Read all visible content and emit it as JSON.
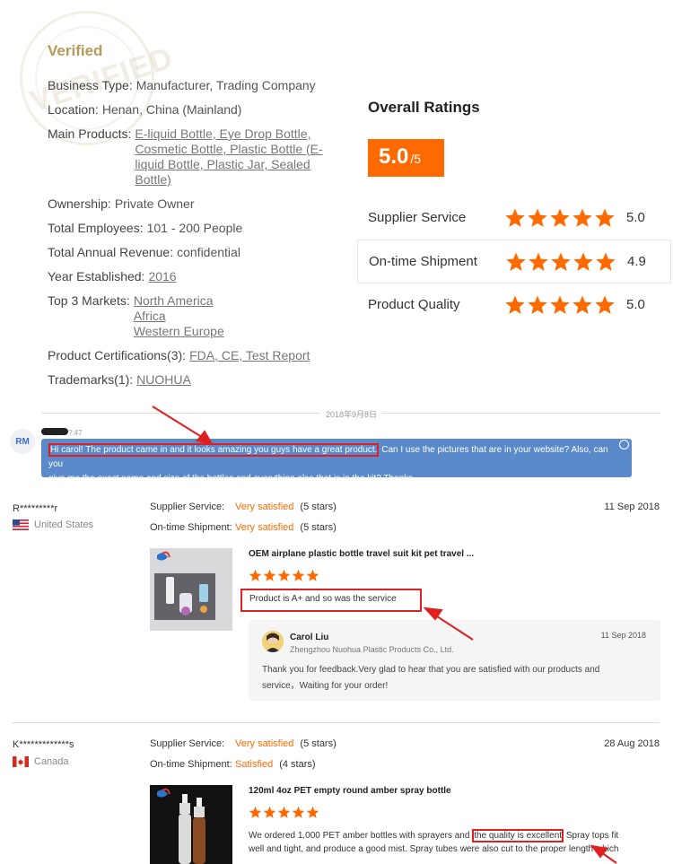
{
  "verified": {
    "title": "Verified",
    "stamp_text": "VERIFIED",
    "business_type": {
      "label": "Business Type:",
      "value": "Manufacturer, Trading Company"
    },
    "location": {
      "label": "Location:",
      "value": "Henan, China (Mainland)"
    },
    "main_products": {
      "label": "Main Products:",
      "lines": [
        "E-liquid Bottle, Eye Drop Bottle,",
        "Cosmetic Bottle, Plastic Bottle (E-",
        "liquid Bottle, Plastic Jar, Sealed",
        "Bottle)"
      ]
    },
    "ownership": {
      "label": "Ownership:",
      "value": "Private Owner"
    },
    "employees": {
      "label": "Total Employees:",
      "value": "101 - 200 People"
    },
    "revenue": {
      "label": "Total Annual Revenue:",
      "value": "confidential"
    },
    "year": {
      "label": "Year Established:",
      "value": "2016"
    },
    "markets": {
      "label": "Top 3 Markets:",
      "lines": [
        "North America",
        "Africa",
        "Western Europe"
      ]
    },
    "certifications": {
      "label": "Product Certifications(3):",
      "value": "FDA, CE, Test Report"
    },
    "trademarks": {
      "label": "Trademarks(1):",
      "value": "NUOHUA"
    }
  },
  "ratings": {
    "title": "Overall Ratings",
    "score": "5.0",
    "score_max": "/5",
    "star_color": "#ff6a00",
    "rows": [
      {
        "label": "Supplier Service",
        "value": "5.0",
        "stars": 5
      },
      {
        "label": "On-time Shipment",
        "value": "4.9",
        "stars": 5
      },
      {
        "label": "Product Quality",
        "value": "5.0",
        "stars": 5
      }
    ]
  },
  "chat": {
    "date": "2018年9月8日",
    "avatar_initials": "RM",
    "time": "?:47",
    "highlighted": "Hi carol! The product came in and it looks amazing you guys have a great product.",
    "rest": " Can I use the pictures that are in your website? Also, can you",
    "line2": "give me the exact name and size of the bottles and everything else that is in the kit? Thanks"
  },
  "reviews": [
    {
      "reviewer": "R*********r",
      "country": "United States",
      "date": "11 Sep 2018",
      "supplier_service_label": "Supplier Service:",
      "supplier_service": "Very satisfied",
      "supplier_service_stars": "(5 stars)",
      "shipment_label": "On-time Shipment:",
      "shipment": "Very satisfied",
      "shipment_stars": "(5 stars)",
      "product_title": "OEM airplane plastic bottle travel suit kit pet travel ...",
      "rating": 5,
      "comment": "Product is A+ and so was the service",
      "reply": {
        "name": "Carol Liu",
        "company": "Zhengzhou Nuohua Plastic Products Co., Ltd.",
        "date": "11 Sep 2018",
        "text1": "Thank you for feedback.Very glad to hear that you are satisfied with our products and",
        "text2": "service，Waiting for your order!"
      }
    },
    {
      "reviewer": "K*************s",
      "country": "Canada",
      "date": "28 Aug 2018",
      "supplier_service_label": "Supplier Service:",
      "supplier_service": "Very satisfied",
      "supplier_service_stars": "(5 stars)",
      "shipment_label": "On-time Shipment:",
      "shipment": "Satisfied",
      "shipment_stars": "(4 stars)",
      "product_title": "120ml 4oz PET empty round amber spray bottle",
      "rating": 5,
      "comment_pre": "We ordered 1,000 PET amber bottles with sprayers and ",
      "comment_highlight": "the quality is excellent",
      "comment_post": " Spray tops fit",
      "comment_line2": "well and tight, and produce a good mist. Spray tubes were also cut to the proper length which"
    }
  ]
}
